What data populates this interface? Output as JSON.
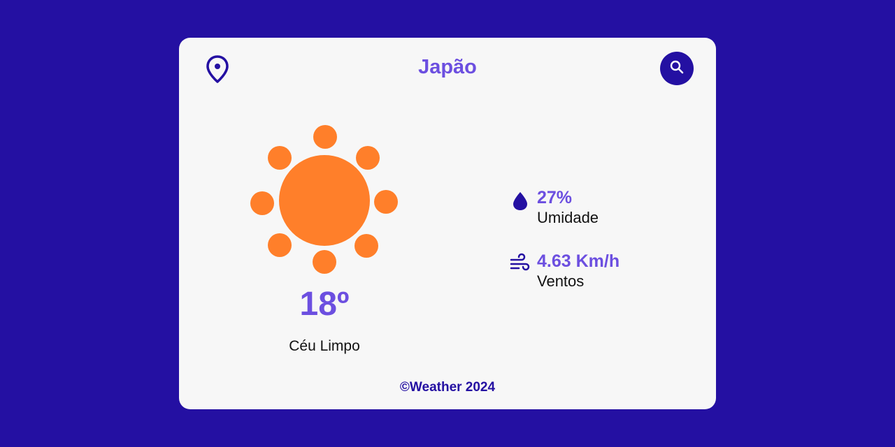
{
  "header": {
    "location_icon": "map-pin-icon",
    "city": "Japão",
    "search_icon": "search-icon"
  },
  "weather": {
    "icon": "sun-icon",
    "temperature": "18º",
    "condition": "Céu Limpo"
  },
  "stats": {
    "humidity": {
      "icon": "water-drop-icon",
      "value": "27%",
      "label": "Umidade"
    },
    "wind": {
      "icon": "wind-icon",
      "value": "4.63 Km/h",
      "label": "Ventos"
    }
  },
  "footer": {
    "text": "©Weather 2024"
  },
  "colors": {
    "background": "#2410a2",
    "card": "#f7f7f7",
    "accent": "#6c4fe0",
    "sun": "#ff7f2a"
  }
}
